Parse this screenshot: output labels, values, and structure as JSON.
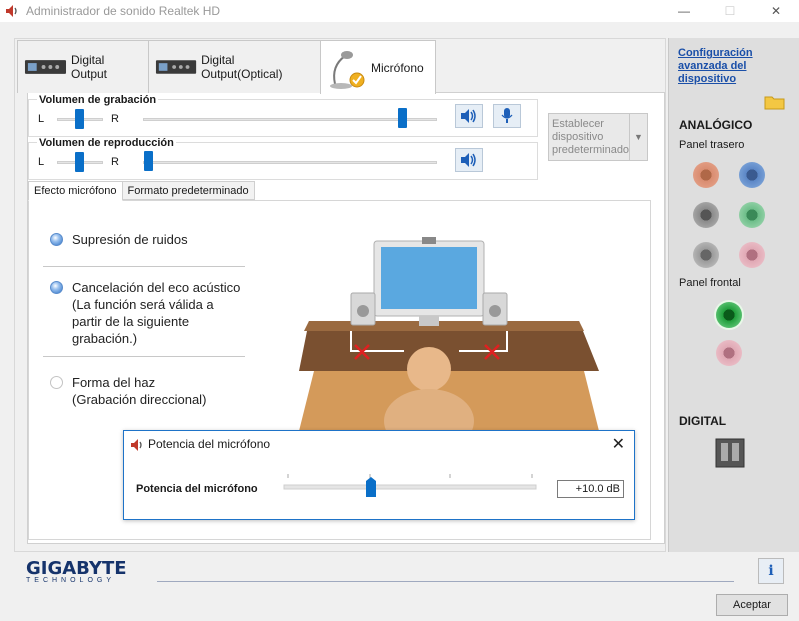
{
  "window": {
    "title": "Administrador de sonido Realtek HD",
    "minimize": "—",
    "maximize": "☐",
    "close": "✕"
  },
  "tabs": [
    {
      "label": "Digital Output"
    },
    {
      "label": "Digital Output(Optical)"
    },
    {
      "label": "Micrófono"
    }
  ],
  "recording": {
    "title": "Volumen de grabación",
    "left": "L",
    "right": "R",
    "balance": 0.5,
    "level": 0.9
  },
  "playback": {
    "title": "Volumen de reproducción",
    "left": "L",
    "right": "R",
    "balance": 0.5,
    "level": 0.0
  },
  "default_device": {
    "label": "Establecer dispositivo predeterminado"
  },
  "subtabs": [
    {
      "label": "Efecto micrófono"
    },
    {
      "label": "Formato predeterminado"
    }
  ],
  "effects": [
    {
      "label": "Supresión de ruidos",
      "selected": true
    },
    {
      "label": "Cancelación del eco acústico\n(La función será válida a\npartir de la siguiente\ngrabación.)",
      "selected": true
    },
    {
      "label": "Forma del haz\n(Grabación direccional)",
      "selected": false
    }
  ],
  "sidebar": {
    "advanced_link": "Configuración avanzada del dispositivo",
    "analog": "ANALÓGICO",
    "rear_panel": "Panel trasero",
    "front_panel": "Panel frontal",
    "digital": "DIGITAL",
    "rear_jacks": [
      "#d98c70",
      "#5b86c6",
      "#8a8a8a",
      "#6cbd88",
      "#9a9a9a",
      "#e0a8b4"
    ],
    "front_jacks": [
      "#1f9d3a",
      "#e0a8b4"
    ]
  },
  "popup": {
    "title": "Potencia del micrófono",
    "label": "Potencia del micrófono",
    "value": "+10.0 dB",
    "close": "✕",
    "level": 0.33
  },
  "footer": {
    "brand": "GIGABYTE",
    "brand_sub": "TECHNOLOGY",
    "accept": "Aceptar",
    "info": "i"
  }
}
